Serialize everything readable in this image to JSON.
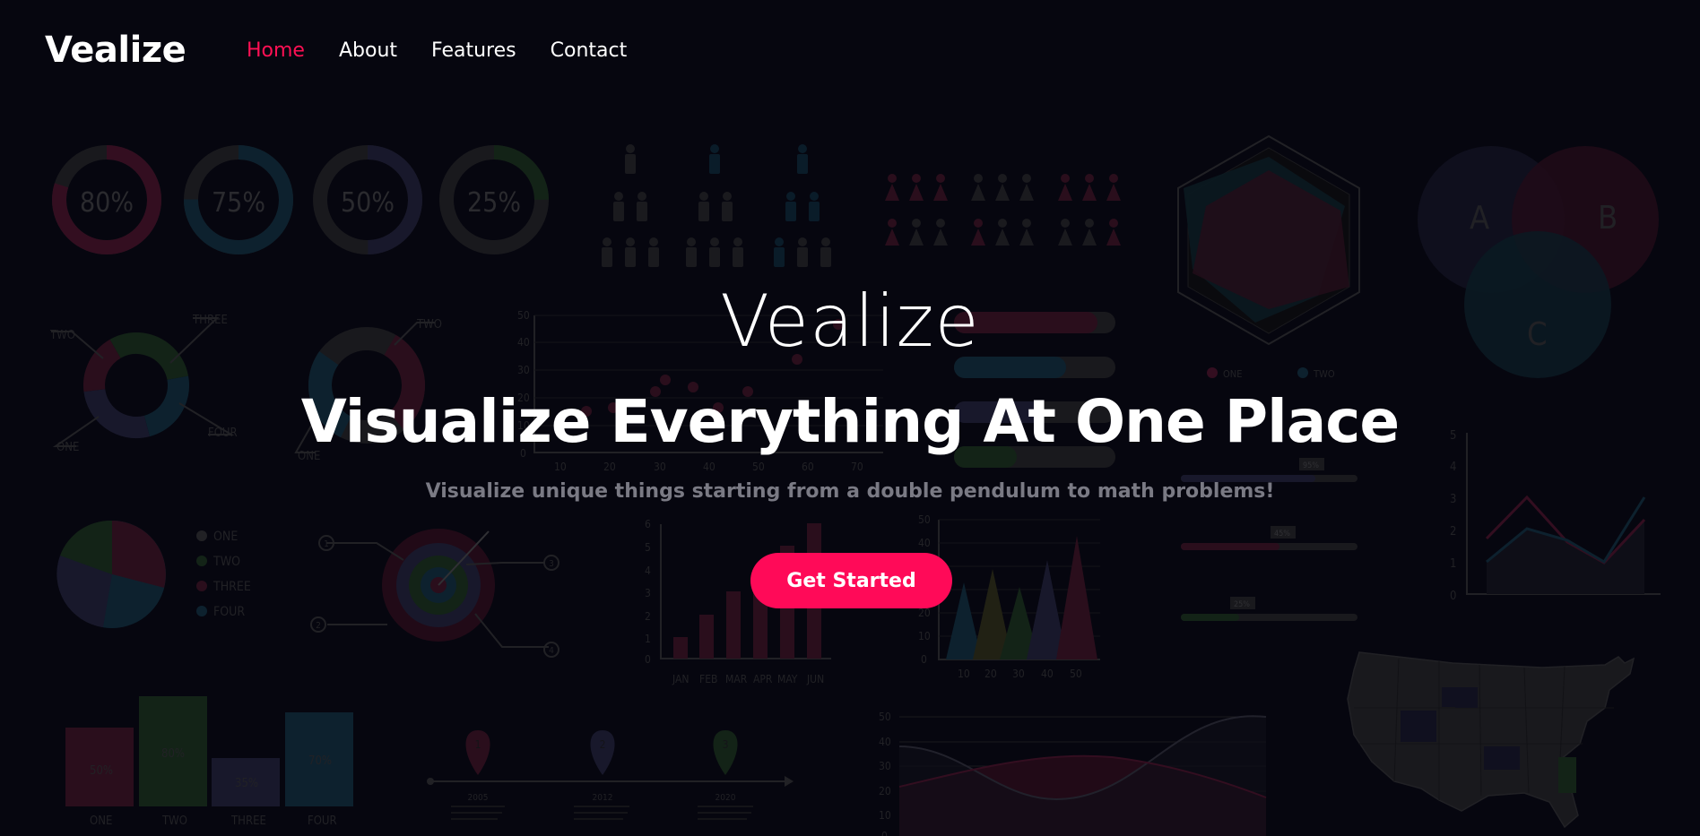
{
  "nav": {
    "brand": "Vealize",
    "links": [
      "Home",
      "About",
      "Features",
      "Contact"
    ],
    "active_index": 0,
    "active_color": "#ff1054"
  },
  "hero": {
    "brand": "Vealize",
    "headline": "Visualize Everything At One Place",
    "subtitle": "Visualize unique things starting from a double pendulum to math problems!",
    "cta_label": "Get Started",
    "cta_color": "#ff0a58"
  },
  "background_infographics": {
    "donut_percentages": [
      "80%",
      "75%",
      "50%",
      "25%"
    ],
    "callout_labels_left": [
      "TWO",
      "THREE",
      "ONE",
      "FOUR"
    ],
    "callout_labels_right": [
      "TWO",
      "ONE"
    ],
    "scatter_y_ticks": [
      "50",
      "40",
      "30",
      "20",
      "10",
      "0"
    ],
    "scatter_x_ticks": [
      "10",
      "20",
      "30",
      "40",
      "50",
      "60",
      "70"
    ],
    "pie_legend": [
      "ONE",
      "TWO",
      "THREE",
      "FOUR"
    ],
    "target_markers": [
      "1",
      "2",
      "3",
      "4"
    ],
    "month_bar_y_ticks": [
      "6",
      "5",
      "4",
      "3",
      "2",
      "1",
      "0"
    ],
    "month_bar_x_ticks": [
      "JAN",
      "FEB",
      "MAR",
      "APR",
      "MAY",
      "JUN"
    ],
    "triangle_y_ticks": [
      "50",
      "40",
      "30",
      "20",
      "10",
      "0"
    ],
    "triangle_x_ticks": [
      "10",
      "20",
      "30",
      "40",
      "50"
    ],
    "radar_legend": [
      "ONE",
      "TWO"
    ],
    "venn_labels": [
      "A",
      "B",
      "C"
    ],
    "slider_badges": [
      "95%",
      "45%",
      "25%"
    ],
    "line_y_ticks": [
      "5",
      "4",
      "3",
      "2",
      "1",
      "0"
    ],
    "bar_values": [
      "50%",
      "80%",
      "35%",
      "70%"
    ],
    "bar_labels": [
      "ONE",
      "TWO",
      "THREE",
      "FOUR"
    ],
    "timeline_markers": [
      "1",
      "2",
      "3"
    ],
    "timeline_years": [
      "2005",
      "2012",
      "2020"
    ],
    "area_y_ticks": [
      "50",
      "40",
      "30",
      "20",
      "10",
      "0"
    ]
  }
}
